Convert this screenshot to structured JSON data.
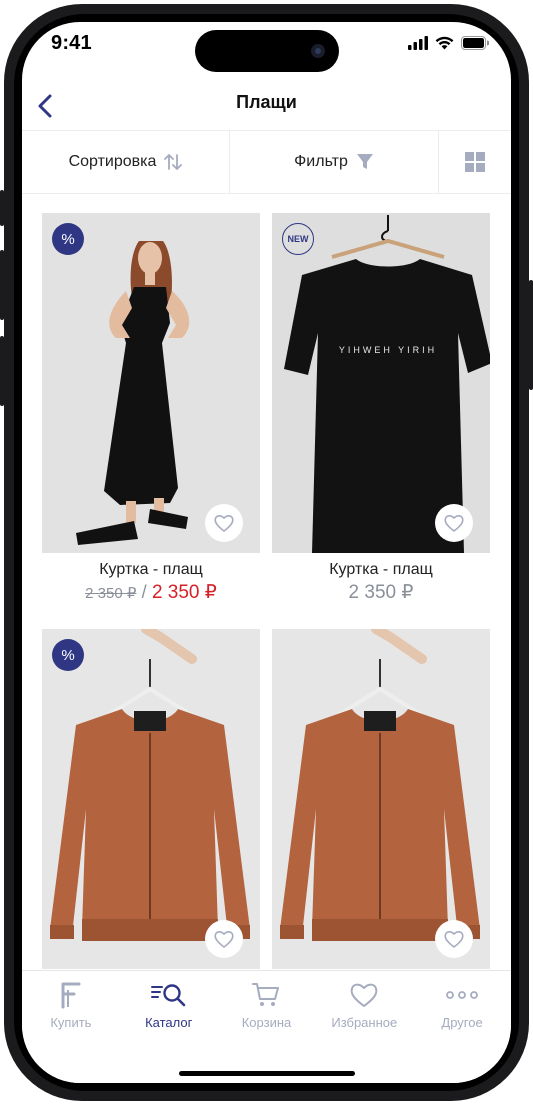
{
  "status": {
    "time": "9:41"
  },
  "header": {
    "title": "Плащи"
  },
  "toolbar": {
    "sort_label": "Сортировка",
    "filter_label": "Фильтр"
  },
  "products": [
    {
      "name": "Куртка - плащ",
      "old_price": "2 350 ₽",
      "separator": "/",
      "price": "2 350 ₽",
      "badge": "%",
      "image": "woman-black-dress"
    },
    {
      "name": "Куртка - плащ",
      "price": "2 350 ₽",
      "badge": "NEW",
      "image": "black-tshirt",
      "shirt_text": "YIHWEH YIRIH"
    },
    {
      "badge": "%",
      "image": "brown-bomber-jacket"
    },
    {
      "image": "brown-bomber-jacket"
    }
  ],
  "tabbar": {
    "items": [
      {
        "label": "Купить",
        "icon": "brand-f-icon"
      },
      {
        "label": "Каталог",
        "icon": "catalog-search-icon",
        "active": true
      },
      {
        "label": "Корзина",
        "icon": "cart-icon"
      },
      {
        "label": "Избранное",
        "icon": "heart-icon"
      },
      {
        "label": "Другое",
        "icon": "more-dots-icon"
      }
    ]
  },
  "colors": {
    "accent": "#2f3785",
    "sale_price": "#d61f26",
    "muted": "#8a8f99",
    "inactive_tab": "#a6acbf"
  }
}
